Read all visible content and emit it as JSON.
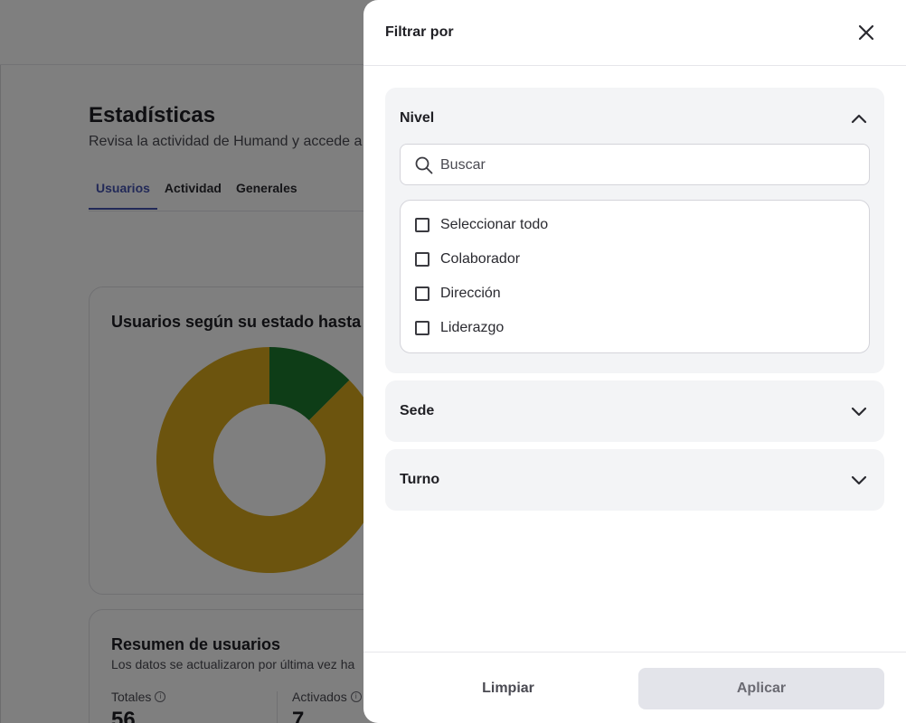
{
  "background": {
    "title": "Estadísticas",
    "subtitle": "Revisa la actividad de Humand y accede a",
    "tabs": [
      {
        "label": "Usuarios",
        "active": true
      },
      {
        "label": "Actividad",
        "active": false
      },
      {
        "label": "Generales",
        "active": false
      }
    ],
    "chart_card": {
      "title": "Usuarios según su estado hasta h",
      "colors": {
        "green": "#1d7a2e",
        "yellow": "#d9a81c"
      }
    },
    "summary_card": {
      "title": "Resumen de usuarios",
      "subtitle": "Los datos se actualizaron por última vez ha",
      "stats": [
        {
          "label": "Totales",
          "value": "56"
        },
        {
          "label": "Activados",
          "value": "7"
        }
      ]
    }
  },
  "chart_data": {
    "type": "pie",
    "title": "Usuarios según su estado hasta h",
    "slices": [
      {
        "label": "",
        "value": 7,
        "color": "#1d7a2e"
      },
      {
        "label": "",
        "value": 49,
        "color": "#d9a81c"
      }
    ]
  },
  "drawer": {
    "title": "Filtrar por",
    "close_icon": "close-icon",
    "sections": [
      {
        "title": "Nivel",
        "expanded": true,
        "search_placeholder": "Buscar",
        "options": [
          {
            "label": "Seleccionar todo",
            "checked": false
          },
          {
            "label": "Colaborador",
            "checked": false
          },
          {
            "label": "Dirección",
            "checked": false
          },
          {
            "label": "Liderazgo",
            "checked": false
          }
        ]
      },
      {
        "title": "Sede",
        "expanded": false
      },
      {
        "title": "Turno",
        "expanded": false
      }
    ],
    "footer": {
      "clear_label": "Limpiar",
      "apply_label": "Aplicar"
    }
  }
}
